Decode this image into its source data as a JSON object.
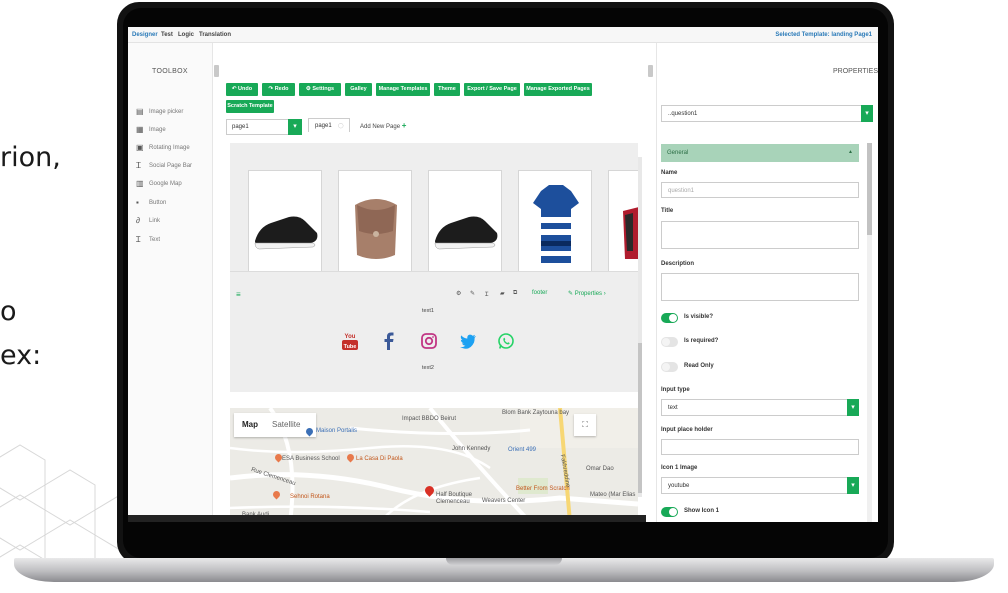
{
  "background": {
    "line1": "rion,",
    "line2": "o",
    "line3": "ex:"
  },
  "topbar": {
    "tabs": [
      "Designer",
      "Test",
      "Logic",
      "Translation"
    ],
    "selected_template": "Selected Template: landing Page1"
  },
  "toolbox": {
    "title": "TOOLBOX",
    "items": [
      {
        "label": "Image picker",
        "icon": "image-picker-icon"
      },
      {
        "label": "Image",
        "icon": "image-icon"
      },
      {
        "label": "Rotating Image",
        "icon": "rotating-image-icon"
      },
      {
        "label": "Social Page Bar",
        "icon": "social-bar-icon"
      },
      {
        "label": "Google Map",
        "icon": "map-icon"
      },
      {
        "label": "Button",
        "icon": "button-icon"
      },
      {
        "label": "Link",
        "icon": "link-icon"
      },
      {
        "label": "Text",
        "icon": "text-icon"
      }
    ]
  },
  "toolbar": {
    "undo": "Undo",
    "redo": "Redo",
    "settings": "Settings",
    "gallery": "Galley",
    "manage_templates": "Manage Templates",
    "theme": "Theme",
    "export_save": "Export / Save Page",
    "manage_exported": "Manage Exported Pages",
    "scratch_template": "Scratch Template"
  },
  "pages": {
    "selected": "page1",
    "tab": "page1",
    "add_new": "Add New Page"
  },
  "canvas": {
    "footer_label": "footer",
    "properties_link": "Properties",
    "text1": "text1",
    "text2": "text2"
  },
  "map": {
    "tab_map": "Map",
    "tab_satellite": "Satellite",
    "labels": [
      "Maison Portalis",
      "Impact BBDO Beirut",
      "Blom Bank Zaytouna bay",
      "ESA Business School",
      "La Casa Di Paola",
      "John Kennedy",
      "Orient 499",
      "Omar Dao",
      "Sehnoi Rotana",
      "Half Boutique Clemenceau",
      "Weavers Center",
      "Better From Scratch",
      "Mateo (Mar Elias",
      "Bank Audi",
      "Rue Clemenceau",
      "Fakhreddine"
    ]
  },
  "properties": {
    "title": "PROPERTIES",
    "selected_question": "..question1",
    "section": "General",
    "name_label": "Name",
    "name_value": "question1",
    "title_label": "Title",
    "description_label": "Description",
    "is_visible": "Is visible?",
    "is_required": "Is required?",
    "read_only": "Read Only",
    "input_type_label": "Input type",
    "input_type_value": "text",
    "placeholder_label": "Input place holder",
    "icon1_label": "Icon 1 Image",
    "icon1_value": "youtube",
    "show_icon1": "Show Icon 1"
  },
  "colors": {
    "accent": "#18a957",
    "link": "#2a7ab8",
    "general_section": "#a8d3b9"
  }
}
